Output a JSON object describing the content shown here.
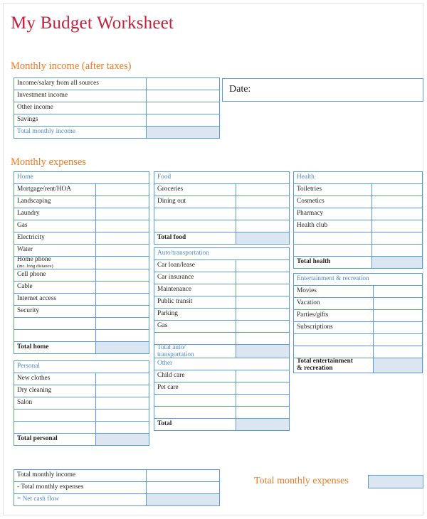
{
  "document": {
    "title": "My Budget Worksheet",
    "income_heading": "Monthly income (after taxes)",
    "expenses_heading": "Monthly expenses"
  },
  "colors": {
    "title": "#C4213C",
    "heading": "#F07820",
    "border": "#5B9BD5",
    "category": "#4E87C7",
    "shaded_fill": "#DCE6F1"
  },
  "date_box": {
    "label": "Date:",
    "value": ""
  },
  "income": {
    "rows": [
      {
        "label": "Income/salary from all sources",
        "value": ""
      },
      {
        "label": "Investment income",
        "value": ""
      },
      {
        "label": "Other income",
        "value": ""
      },
      {
        "label": "Savings",
        "value": ""
      }
    ],
    "total": {
      "label": "Total monthly income",
      "value": ""
    }
  },
  "expenses": {
    "home": {
      "category": "Home",
      "rows": [
        {
          "label": "Mortgage/rent/HOA",
          "value": ""
        },
        {
          "label": "Landscaping",
          "value": ""
        },
        {
          "label": "Laundry",
          "value": ""
        },
        {
          "label": "Gas",
          "value": ""
        },
        {
          "label": "Electricity",
          "value": ""
        },
        {
          "label": "Water",
          "value": ""
        },
        {
          "label": "Home phone",
          "sublabel": "(inc. long distance)",
          "value": ""
        },
        {
          "label": "Cell phone",
          "value": ""
        },
        {
          "label": "Cable",
          "value": ""
        },
        {
          "label": "Internet access",
          "value": ""
        },
        {
          "label": "Security",
          "value": ""
        },
        {
          "label": "",
          "value": ""
        },
        {
          "label": "",
          "value": ""
        }
      ],
      "total": {
        "label": "Total home",
        "value": ""
      }
    },
    "personal": {
      "category": "Personal",
      "rows": [
        {
          "label": "New clothes",
          "value": ""
        },
        {
          "label": "Dry cleaning",
          "value": ""
        },
        {
          "label": "Salon",
          "value": ""
        },
        {
          "label": "",
          "value": ""
        },
        {
          "label": "",
          "value": ""
        }
      ],
      "total": {
        "label": "Total personal",
        "value": ""
      }
    },
    "food": {
      "category": "Food",
      "rows": [
        {
          "label": "Groceries",
          "value": ""
        },
        {
          "label": "Dining out",
          "value": ""
        },
        {
          "label": "",
          "value": ""
        },
        {
          "label": "",
          "value": ""
        }
      ],
      "total": {
        "label": "Total food",
        "value": ""
      }
    },
    "auto": {
      "category": "Auto/transportation",
      "rows": [
        {
          "label": "Car loan/lease",
          "value": ""
        },
        {
          "label": "Car insurance",
          "value": ""
        },
        {
          "label": "Maintenance",
          "value": ""
        },
        {
          "label": "Public transit",
          "value": ""
        },
        {
          "label": "Parking",
          "value": ""
        },
        {
          "label": "Gas",
          "value": ""
        },
        {
          "label": "",
          "value": ""
        }
      ],
      "total": {
        "label": "Total auto/",
        "label2": "transportation",
        "value": ""
      }
    },
    "other": {
      "category": "Other",
      "rows": [
        {
          "label": "Child care",
          "value": ""
        },
        {
          "label": "Pet care",
          "value": ""
        },
        {
          "label": "",
          "value": ""
        },
        {
          "label": "",
          "value": ""
        }
      ],
      "total": {
        "label": "Total",
        "value": ""
      }
    },
    "health": {
      "category": "Health",
      "rows": [
        {
          "label": "Toiletries",
          "value": ""
        },
        {
          "label": "Cosmetics",
          "value": ""
        },
        {
          "label": "Pharmacy",
          "value": ""
        },
        {
          "label": "Health club",
          "value": ""
        },
        {
          "label": "",
          "value": ""
        },
        {
          "label": "",
          "value": ""
        }
      ],
      "total": {
        "label": "Total health",
        "value": ""
      }
    },
    "entertainment": {
      "category": "Entertainment & recreation",
      "rows": [
        {
          "label": "Movies",
          "value": ""
        },
        {
          "label": "Vacation",
          "value": ""
        },
        {
          "label": "Parties/gifts",
          "value": ""
        },
        {
          "label": "Subscriptions",
          "value": ""
        },
        {
          "label": "",
          "value": ""
        },
        {
          "label": "",
          "value": ""
        }
      ],
      "total": {
        "label": "Total entertainment",
        "label2": "& recreation",
        "value": ""
      }
    }
  },
  "summary": {
    "rows": [
      {
        "label": "Total monthly income",
        "value": ""
      },
      {
        "label": "- Total monthly expenses",
        "value": ""
      }
    ],
    "net": {
      "label": "= Net cash flow",
      "value": ""
    },
    "total_expenses_label": "Total monthly expenses",
    "total_expenses_value": ""
  }
}
